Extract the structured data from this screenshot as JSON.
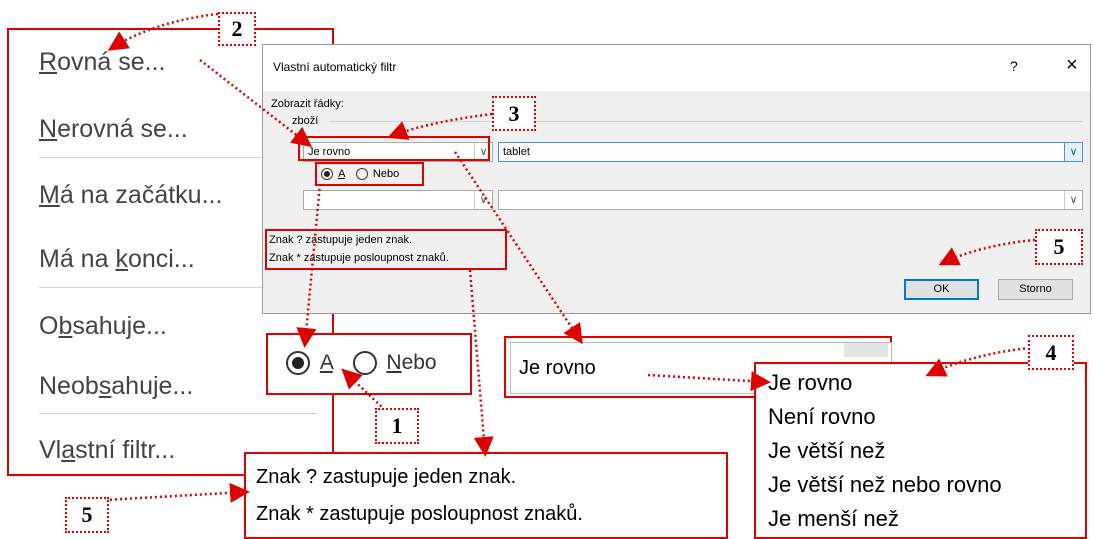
{
  "left_menu": {
    "items": [
      {
        "pre": "",
        "u": "R",
        "post": "ovná se..."
      },
      {
        "pre": "",
        "u": "N",
        "post": "erovná se..."
      },
      {
        "pre": "",
        "u": "M",
        "post": "á na začátku..."
      },
      {
        "pre": "Má na ",
        "u": "k",
        "post": "onci..."
      },
      {
        "pre": "O",
        "u": "b",
        "post": "sahuje..."
      },
      {
        "pre": "Neob",
        "u": "s",
        "post": "ahuje..."
      },
      {
        "pre": "Vl",
        "u": "a",
        "post": "stní filtr..."
      }
    ]
  },
  "dialog": {
    "title": "Vlastní automatický filtr",
    "help": "?",
    "close": "×",
    "show_rows_label": "Zobrazit řádky:",
    "field_label": "zboží",
    "operator1": "Je rovno",
    "value1": "tablet",
    "operator2": "",
    "value2": "",
    "radio_and": "A",
    "radio_or": "Nebo",
    "hint1": "Znak ? zastupuje jeden znak.",
    "hint2": "Znak * zastupuje posloupnost znaků.",
    "ok_label": "OK",
    "cancel_label": "Storno",
    "arrow_glyph": "∨"
  },
  "zoom": {
    "radio_and": "A",
    "radio_or": "Nebo",
    "operator": "Je rovno",
    "list_items": [
      "Je rovno",
      "Není rovno",
      "Je větší než",
      "Je větší než nebo rovno",
      "Je menší než"
    ],
    "hint1": "Znak ? zastupuje jeden znak.",
    "hint2": "Znak * zastupuje posloupnost znaků."
  },
  "badges": {
    "b1": "1",
    "b2": "2",
    "b3": "3",
    "b4": "4",
    "b5a": "5",
    "b5b": "5"
  },
  "colors": {
    "annotation": "#e00000",
    "ok_border": "#0078d7"
  }
}
